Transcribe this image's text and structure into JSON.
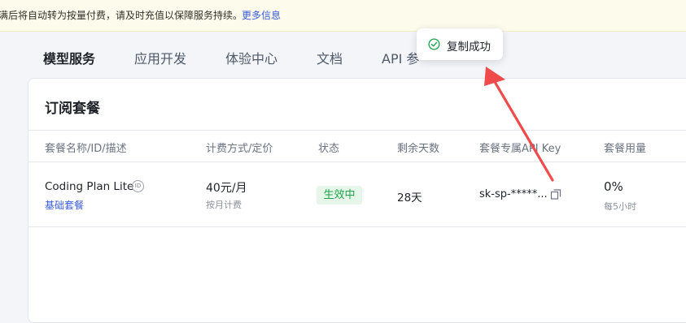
{
  "notice": {
    "text": "满后将自动转为按量付费，请及时充值以保障服务持续。",
    "more_link": "更多信息"
  },
  "nav": {
    "tabs": [
      {
        "label": "模型服务",
        "active": true
      },
      {
        "label": "应用开发",
        "active": false
      },
      {
        "label": "体验中心",
        "active": false
      },
      {
        "label": "文档",
        "active": false
      },
      {
        "label": "API 参",
        "active": false
      }
    ]
  },
  "card": {
    "title": "订阅套餐",
    "columns": [
      "套餐名称/ID/描述",
      "计费方式/定价",
      "状态",
      "剩余天数",
      "套餐专属API Key",
      "套餐用量"
    ],
    "rows": [
      {
        "name": "Coding Plan Lite",
        "id_icon_label": "ID",
        "desc": "基础套餐",
        "price": "40元/月",
        "billing": "按月计费",
        "status": "生效中",
        "days": "28天",
        "api_key": "sk-sp-*****...",
        "usage": "0%",
        "usage_period": "每5小时"
      }
    ]
  },
  "toast": {
    "text": "复制成功"
  },
  "colors": {
    "accent": "#3a5bd9",
    "success": "#1da34b",
    "arrow": "#ef4b4b"
  }
}
